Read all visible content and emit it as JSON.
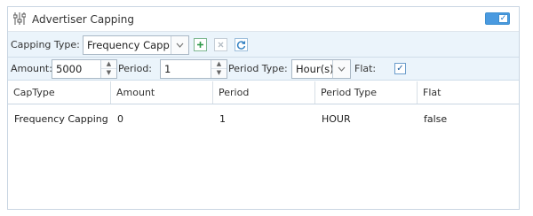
{
  "panel": {
    "title": "Advertiser Capping",
    "enabled": true
  },
  "toolbar": {
    "capping_type_label": "Capping Type:",
    "capping_type_value": "Frequency Capp"
  },
  "filters": {
    "amount_label": "Amount:",
    "amount_value": "5000",
    "period_label": "Period:",
    "period_value": "1",
    "period_type_label": "Period Type:",
    "period_type_value": "Hour(s)",
    "flat_label": "Flat:",
    "flat_checked": true
  },
  "table": {
    "columns": [
      "CapType",
      "Amount",
      "Period",
      "Period Type",
      "Flat"
    ],
    "rows": [
      [
        "Frequency Capping",
        "0",
        "1",
        "HOUR",
        "false"
      ]
    ]
  },
  "icons": {
    "sliders": "sliders-icon",
    "add": "add-icon",
    "remove": "remove-icon",
    "refresh": "refresh-icon",
    "check": "check-icon"
  },
  "colors": {
    "accent": "#4a9ae0",
    "toolbar_bg": "#ebf4fb",
    "add_green": "#2e9a4a"
  }
}
